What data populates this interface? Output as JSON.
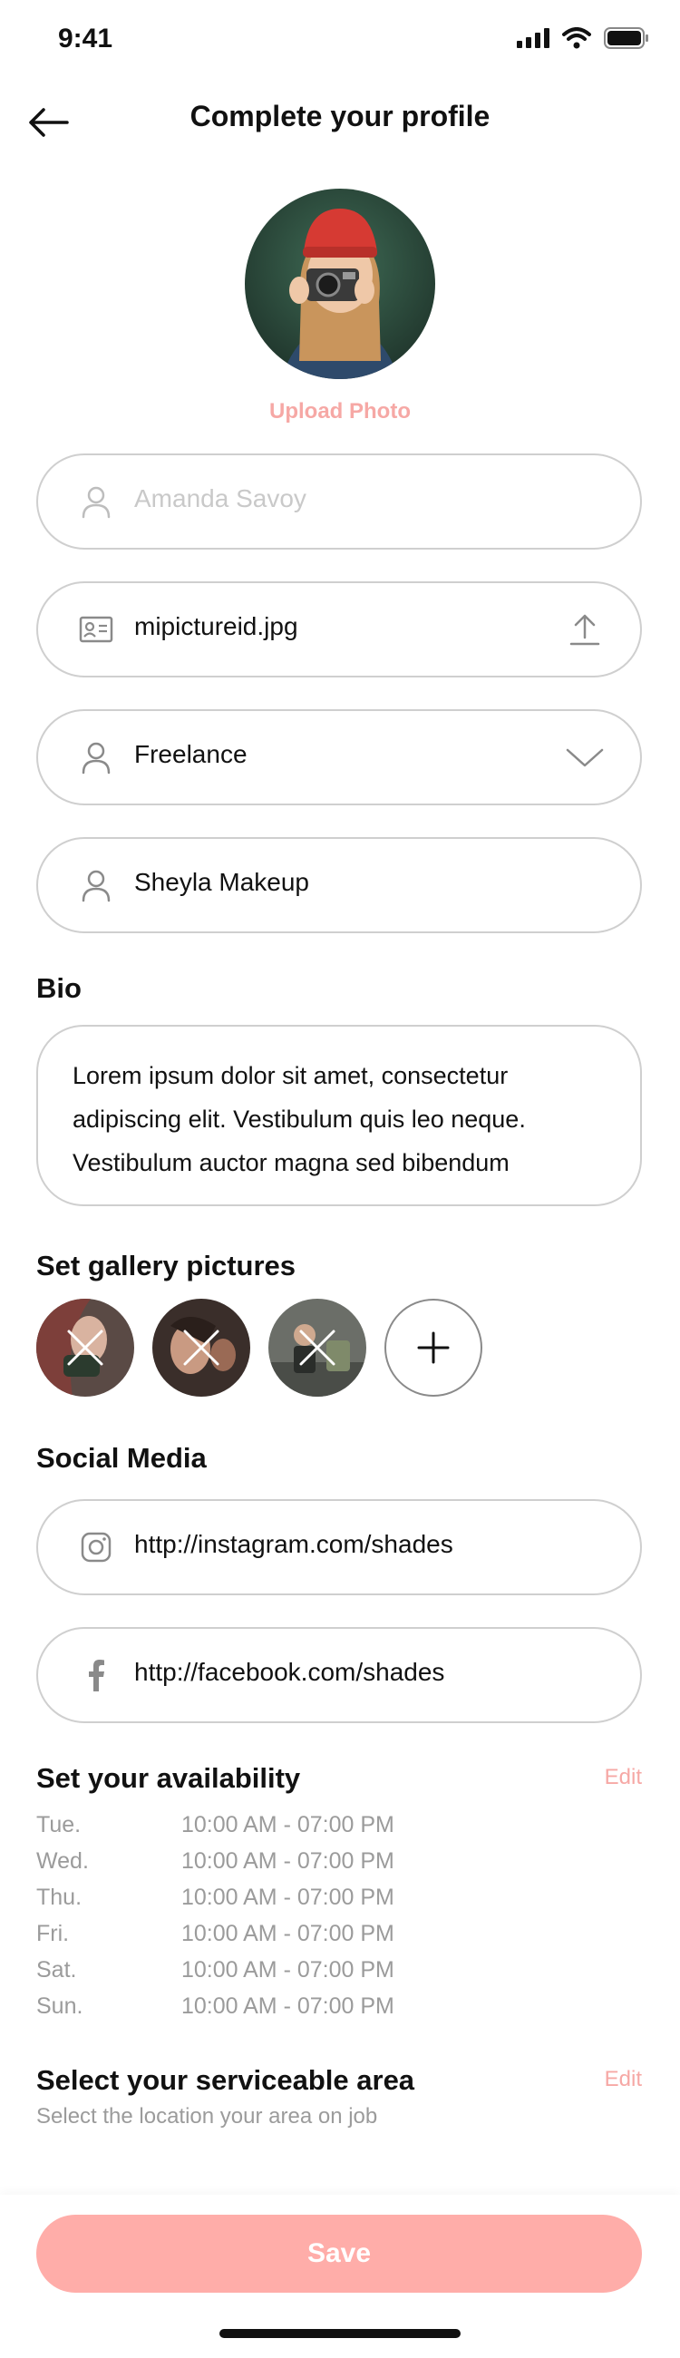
{
  "status_bar": {
    "time": "9:41"
  },
  "header": {
    "title": "Complete your profile",
    "back_icon": "arrow-left-icon"
  },
  "profile_photo": {
    "upload_label": "Upload Photo"
  },
  "fields": {
    "name": {
      "placeholder": "Amanda Savoy",
      "icon": "user-icon"
    },
    "id_file": {
      "value": "mipictureid.jpg",
      "icon": "id-card-icon",
      "trailing_icon": "upload-icon"
    },
    "work_type": {
      "value": "Freelance",
      "icon": "user-icon",
      "trailing_icon": "chevron-down-icon"
    },
    "business_name": {
      "value": "Sheyla Makeup",
      "icon": "user-icon"
    }
  },
  "bio": {
    "title": "Bio",
    "text": "Lorem ipsum dolor sit amet, consectetur adipiscing elit. Vestibulum quis leo neque. Vestibulum auctor magna sed bibendum"
  },
  "gallery": {
    "title": "Set gallery pictures",
    "add_icon": "plus-icon",
    "remove_icon": "close-icon"
  },
  "social": {
    "title": "Social Media",
    "instagram": {
      "value": "http://instagram.com/shades",
      "icon": "instagram-icon"
    },
    "facebook": {
      "value": "http://facebook.com/shades",
      "icon": "facebook-icon"
    }
  },
  "availability": {
    "title": "Set your availability",
    "edit_label": "Edit",
    "rows": [
      {
        "day": "Tue.",
        "time": "10:00 AM - 07:00 PM"
      },
      {
        "day": "Wed.",
        "time": "10:00 AM - 07:00 PM"
      },
      {
        "day": "Thu.",
        "time": "10:00 AM - 07:00 PM"
      },
      {
        "day": "Fri.",
        "time": "10:00 AM - 07:00 PM"
      },
      {
        "day": "Sat.",
        "time": "10:00 AM - 07:00 PM"
      },
      {
        "day": "Sun.",
        "time": "10:00 AM - 07:00 PM"
      }
    ]
  },
  "service_area": {
    "title": "Select your serviceable area",
    "edit_label": "Edit",
    "subtitle": "Select the location your area on job"
  },
  "footer": {
    "save_label": "Save"
  },
  "colors": {
    "accent": "#F6A8A5",
    "save_button": "#FFADA9",
    "border": "#CFCFCF",
    "muted_text": "#9B9B9B"
  }
}
